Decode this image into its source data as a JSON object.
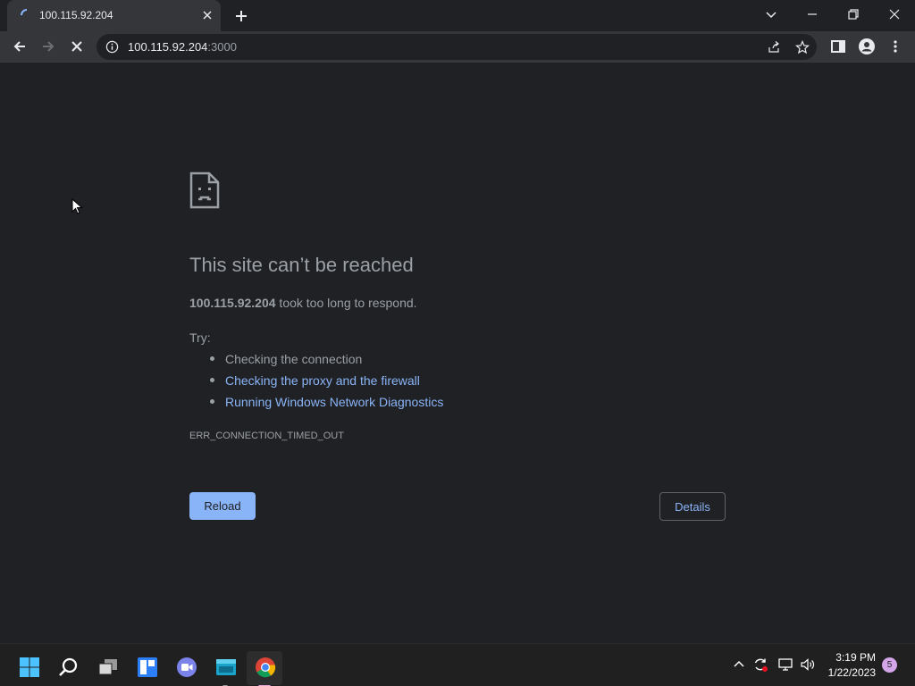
{
  "tab": {
    "title": "100.115.92.204"
  },
  "omnibox": {
    "host": "100.115.92.204",
    "port": ":3000"
  },
  "error": {
    "title": "This site can’t be reached",
    "host_bold": "100.115.92.204",
    "message_rest": " took too long to respond.",
    "try_label": "Try:",
    "suggestions": [
      {
        "text": "Checking the connection",
        "link": false
      },
      {
        "text": "Checking the proxy and the firewall",
        "link": true
      },
      {
        "text": "Running Windows Network Diagnostics",
        "link": true
      }
    ],
    "code": "ERR_CONNECTION_TIMED_OUT",
    "reload_label": "Reload",
    "details_label": "Details"
  },
  "taskbar": {
    "apps": [
      "windows-start-icon",
      "search-icon",
      "task-view-icon",
      "widgets-icon",
      "teams-chat-icon",
      "file-explorer-icon",
      "chrome-icon"
    ],
    "time": "3:19 PM",
    "date": "1/22/2023",
    "notification_count": "5"
  },
  "colors": {
    "accent": "#8ab4f8",
    "background": "#202124",
    "toolbar": "#35363a",
    "text_secondary": "#9aa0a6"
  }
}
